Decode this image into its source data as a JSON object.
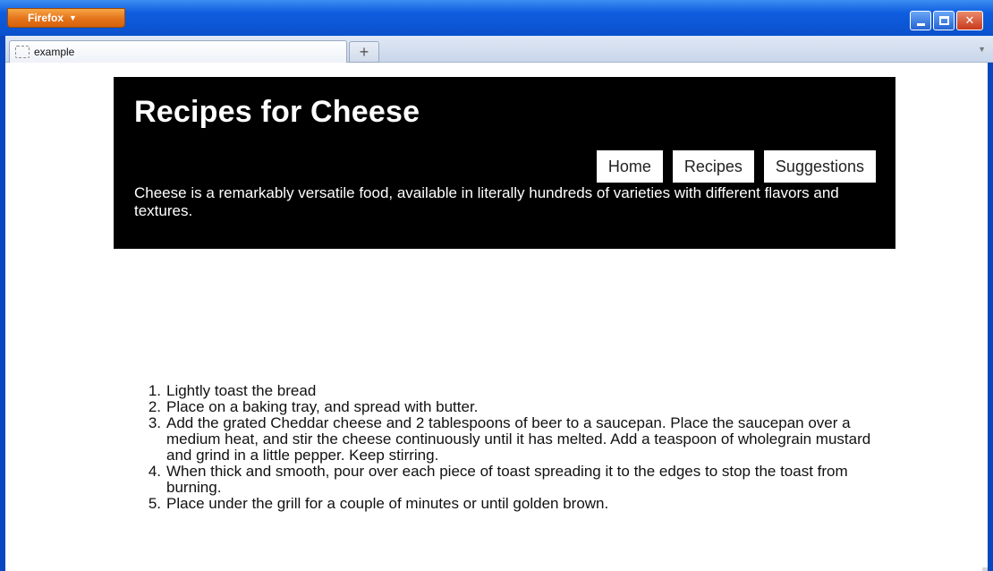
{
  "browser": {
    "menu_button": "Firefox",
    "tab_title": "example",
    "new_tab_symbol": "+",
    "colors": {
      "menu_button": "#e4731a",
      "frame": "#0b58d8"
    }
  },
  "page": {
    "title": "Recipes for Cheese",
    "nav": [
      "Home",
      "Recipes",
      "Suggestions"
    ],
    "intro": "Cheese is a remarkably versatile food, available in literally hundreds of varieties with different flavors and textures.",
    "steps": [
      {
        "num": "1.",
        "text": "Lightly toast the bread"
      },
      {
        "num": "2.",
        "text": "Place on a baking tray, and spread with butter."
      },
      {
        "num": "3.",
        "text": "Add the grated Cheddar cheese and 2 tablespoons of beer to a saucepan. Place the saucepan over a medium heat, and stir the cheese continuously until it has melted. Add a teaspoon of wholegrain mustard and grind in a little pepper. Keep stirring."
      },
      {
        "num": "4.",
        "text": "When thick and smooth, pour over each piece of toast spreading it to the edges to stop the toast from burning."
      },
      {
        "num": "5.",
        "text": "Place under the grill for a couple of minutes or until golden brown."
      }
    ],
    "colors": {
      "header_bg": "#000000",
      "header_text": "#ffffff"
    }
  }
}
